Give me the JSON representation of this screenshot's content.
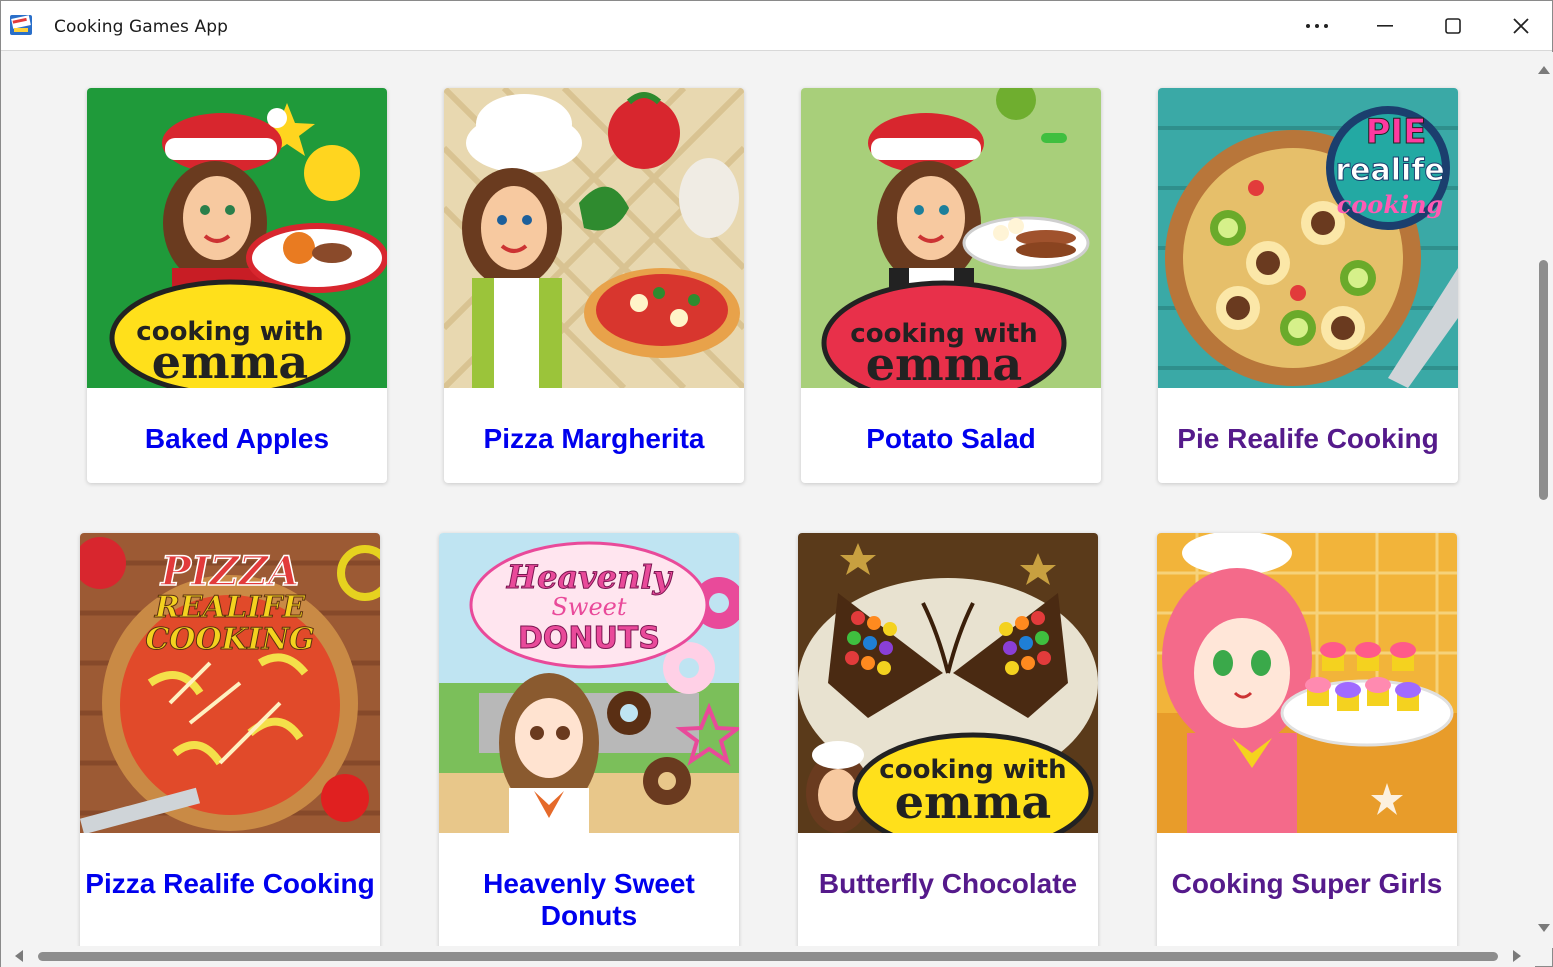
{
  "window": {
    "title": "Cooking Games App",
    "icon": "app-logo-icon",
    "controls": [
      "more-icon",
      "minimize-icon",
      "maximize-icon",
      "close-icon"
    ]
  },
  "games": [
    {
      "title": "Baked Apples",
      "visited": false,
      "thumb": "emma-christmas-green",
      "logo_line1": "cooking with",
      "logo_line2": "emma"
    },
    {
      "title": "Pizza Margherita",
      "visited": false,
      "thumb": "emma-chef-pizza"
    },
    {
      "title": "Potato Salad",
      "visited": false,
      "thumb": "emma-christmas-lightgreen",
      "logo_line1": "cooking with",
      "logo_line2": "emma"
    },
    {
      "title": "Pie Realife Cooking",
      "visited": true,
      "thumb": "pie-top-view",
      "logo_line1": "PIE",
      "logo_line2": "realife",
      "logo_line3": "cooking"
    },
    {
      "title": "Pizza Realife Cooking",
      "visited": false,
      "thumb": "pizza-top-view",
      "logo_line1": "PIZZA",
      "logo_line2": "REALIFE",
      "logo_line3": "COOKING"
    },
    {
      "title": "Heavenly Sweet Donuts",
      "visited": false,
      "thumb": "anime-girl-donuts",
      "logo_line1": "Heavenly",
      "logo_line2": "Sweet",
      "logo_line3": "DONUTS"
    },
    {
      "title": "Butterfly Chocolate",
      "visited": true,
      "thumb": "butterfly-cake",
      "logo_line1": "cooking with",
      "logo_line2": "emma"
    },
    {
      "title": "Cooking Super Girls",
      "visited": true,
      "thumb": "anime-girl-cupcakes"
    }
  ],
  "colors": {
    "link": "#0000ee",
    "visited_link": "#551a8b",
    "background": "#f3f3f3",
    "scrollbar_thumb": "#8d8d8d"
  }
}
